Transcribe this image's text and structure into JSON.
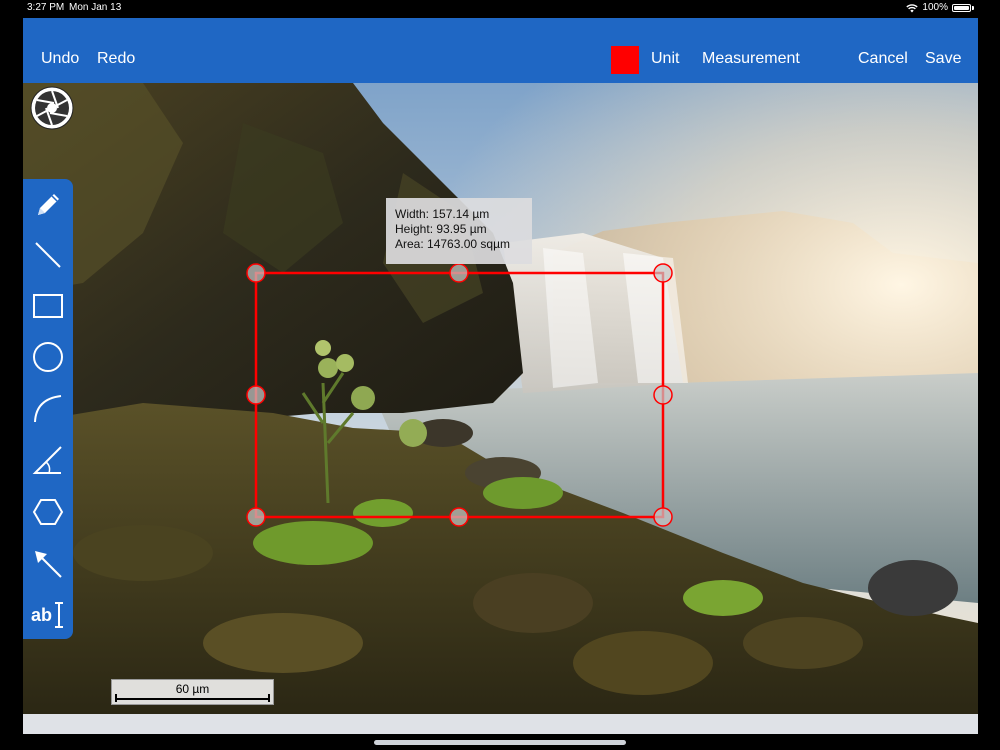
{
  "status_bar": {
    "time": "3:27 PM",
    "date": "Mon Jan 13",
    "battery": "100%",
    "icons": [
      "wifi-icon",
      "battery-icon"
    ]
  },
  "toolbar": {
    "undo_label": "Undo",
    "redo_label": "Redo",
    "color": "#ff0000",
    "unit_label": "Unit",
    "measurement_label": "Measurement",
    "cancel_label": "Cancel",
    "save_label": "Save",
    "accent": "#1f67c4"
  },
  "tools": [
    {
      "name": "pencil-icon"
    },
    {
      "name": "line-icon"
    },
    {
      "name": "rectangle-icon"
    },
    {
      "name": "circle-icon"
    },
    {
      "name": "arc-icon"
    },
    {
      "name": "angle-icon"
    },
    {
      "name": "polygon-icon"
    },
    {
      "name": "arrow-icon"
    },
    {
      "name": "text-tool-icon",
      "label": "ab"
    }
  ],
  "measurement": {
    "width": "Width: 157.14 µm",
    "height": "Height: 93.95 µm",
    "area": "Area: 14763.00 sqµm",
    "stroke_color": "#ff0000"
  },
  "scale_bar": {
    "label": "60 µm"
  }
}
